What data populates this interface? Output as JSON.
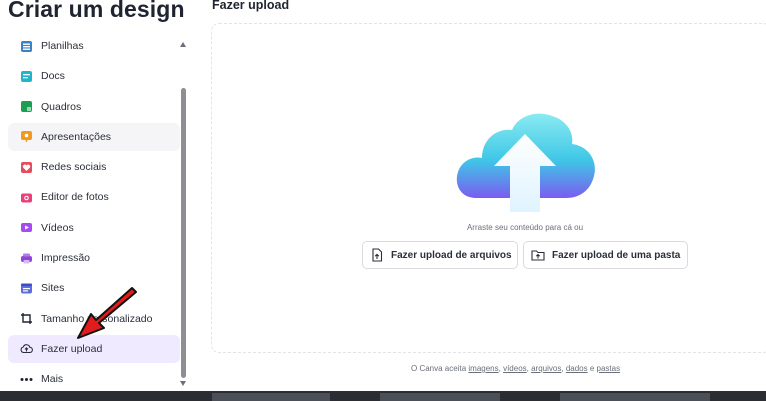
{
  "left_panel": {
    "title": "Criar um design",
    "items": [
      {
        "label": "Planilhas",
        "icon": "spreadsheet-icon",
        "color": "#3b82c4"
      },
      {
        "label": "Docs",
        "icon": "docs-icon",
        "color": "#22b5c9"
      },
      {
        "label": "Quadros",
        "icon": "whiteboard-icon",
        "color": "#1f9d55"
      },
      {
        "label": "Apresentações",
        "icon": "presentation-icon",
        "color": "#f29a1b"
      },
      {
        "label": "Redes sociais",
        "icon": "heart-icon",
        "color": "#e84a5f"
      },
      {
        "label": "Editor de fotos",
        "icon": "camera-icon",
        "color": "#e9407a"
      },
      {
        "label": "Vídeos",
        "icon": "video-icon",
        "color": "#a64bf4"
      },
      {
        "label": "Impressão",
        "icon": "print-icon",
        "color": "#8f45d6"
      },
      {
        "label": "Sites",
        "icon": "sites-icon",
        "color": "#5b6ee1"
      },
      {
        "label": "Tamanho personalizado",
        "icon": "crop-icon",
        "color": "#1f2430"
      },
      {
        "label": "Fazer upload",
        "icon": "cloud-upload-icon",
        "color": "#2b2f3a"
      },
      {
        "label": "Mais",
        "icon": "more-dots-icon",
        "color": "#1f2430"
      }
    ]
  },
  "upload_panel": {
    "title": "Fazer upload",
    "drag_hint": "Arraste seu conteúdo para cá ou",
    "upload_files_label": "Fazer upload de arquivos",
    "upload_folder_label": "Fazer upload de uma pasta",
    "footer": {
      "prefix": "O Canva aceita",
      "images": "imagens",
      "videos": "vídeos",
      "files": "arquivos",
      "data": "dados",
      "and": "e",
      "folders": "pastas"
    }
  },
  "colors": {
    "active_bg": "#efeaff",
    "arrow_red": "#e21c1c",
    "cloud_light": "#7fe3f0",
    "cloud_dark": "#7a5cf0"
  }
}
